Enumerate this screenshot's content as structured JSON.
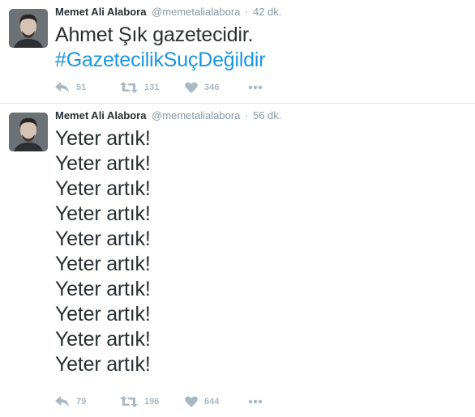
{
  "tweets": [
    {
      "fullname": "Memet Ali Alabora",
      "username": "@memetalialabora",
      "separator": "·",
      "time": "42 dk.",
      "text_line": "Ahmet Şık gazetecidir.",
      "hashtag": "#GazetecilikSuçDeğildir",
      "replies": "51",
      "retweets": "131",
      "likes": "346"
    },
    {
      "fullname": "Memet Ali Alabora",
      "username": "@memetalialabora",
      "separator": "·",
      "time": "56 dk.",
      "lines": [
        "Yeter artık!",
        "Yeter artık!",
        "Yeter artık!",
        "Yeter artık!",
        "Yeter artık!",
        "Yeter artık!",
        "Yeter artık!",
        "Yeter artık!",
        "Yeter artık!",
        "Yeter artık!"
      ],
      "replies": "79",
      "retweets": "196",
      "likes": "644"
    }
  ],
  "icons": {
    "reply": "reply-icon",
    "retweet": "retweet-icon",
    "like": "heart-icon",
    "more": "more-icon"
  },
  "colors": {
    "hashtag": "#1b95e0",
    "meta": "#8899a6",
    "action": "#aab8c2",
    "divider": "#e1e8ed"
  }
}
